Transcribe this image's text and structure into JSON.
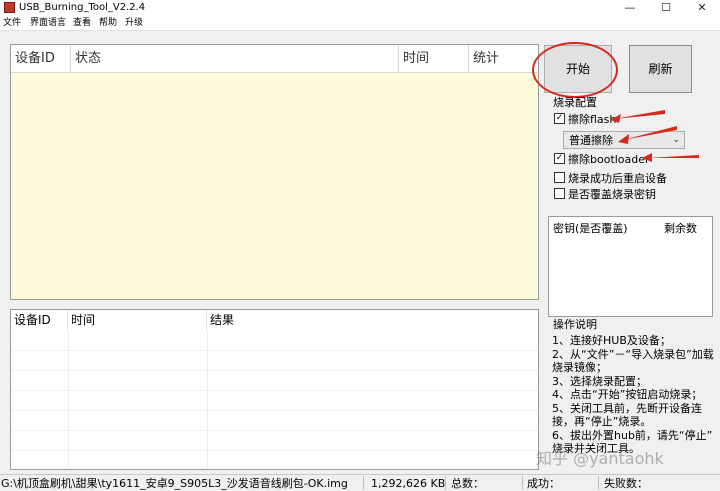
{
  "window": {
    "title": "USB_Burning_Tool_V2.2.4",
    "minimize": "—",
    "maximize": "☐",
    "close": "✕"
  },
  "menu": [
    "文件",
    "界面语言",
    "查看",
    "帮助",
    "升级"
  ],
  "top_table": {
    "columns": [
      "设备ID",
      "状态",
      "时间",
      "统计"
    ]
  },
  "bottom_table": {
    "columns": [
      "设备ID",
      "时间",
      "结果"
    ]
  },
  "buttons": {
    "start": "开始",
    "refresh": "刷新"
  },
  "burn_config": {
    "title": "烧录配置",
    "erase_flash": {
      "label": "擦除flash",
      "checked": true
    },
    "erase_mode": "普通擦除",
    "erase_bootloader": {
      "label": "擦除bootloader",
      "checked": true
    },
    "reboot_after_success": {
      "label": "烧录成功后重启设备",
      "checked": false
    },
    "overwrite_key": {
      "label": "是否覆盖烧录密钥",
      "checked": false
    }
  },
  "keys_list": {
    "col_key": "密钥(是否覆盖)",
    "col_remaining": "剩余数"
  },
  "instructions": {
    "title": "操作说明",
    "lines": [
      "1、连接好HUB及设备；",
      "2、从“文件”－“导入烧录包”加载",
      "烧录镜像；",
      "3、选择烧录配置；",
      "4、点击“开始”按钮启动烧录；",
      "5、关闭工具前，先断开设备连",
      "接，再“停止”烧录。",
      "6、拔出外置hub前，请先“停止”",
      "烧录并关闭工具。"
    ]
  },
  "status_bar": {
    "file_path": "G:\\机顶盒刷机\\甜果\\ty1611_安卓9_S905L3_沙发语音线刷包-OK.img",
    "file_size": "1,292,626 KB",
    "total_label": "总数：",
    "success_label": "成功：",
    "fail_label": "失败数："
  },
  "watermark": "知乎 @yantaohk",
  "colors": {
    "annotation_red": "#d42a1f",
    "grid_bg": "#fdfbdb"
  }
}
